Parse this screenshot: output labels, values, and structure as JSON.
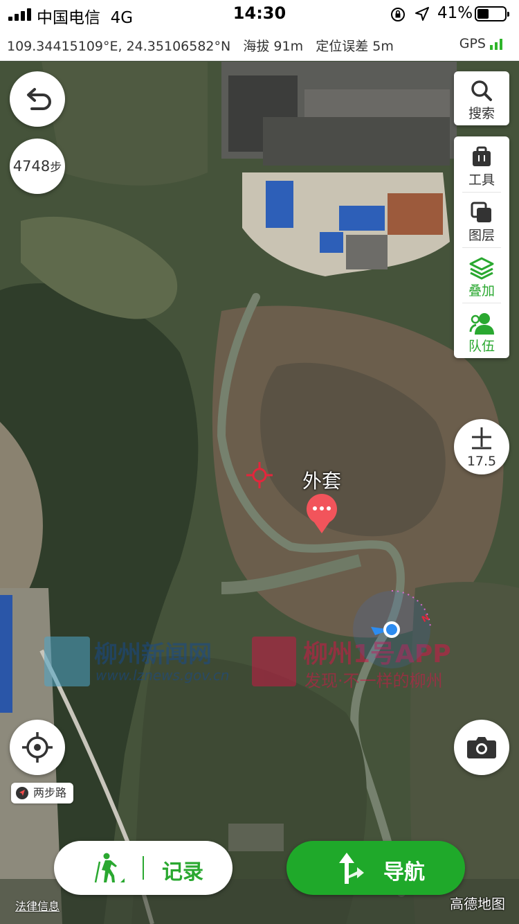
{
  "status_bar": {
    "carrier": "中国电信",
    "network": "4G",
    "time": "14:30",
    "battery_percent": "41%",
    "battery_level": 0.41
  },
  "location_bar": {
    "coordinates": "109.34415109°E, 24.35106582°N",
    "altitude": "海拔 91m",
    "accuracy": "定位误差 5m",
    "gps_label": "GPS"
  },
  "map": {
    "steps": "4748",
    "steps_unit": "步",
    "pin_label": "外套",
    "zoom_level": "17.5",
    "route_chip": "两步路",
    "watermark_left_title": "柳州新闻网",
    "watermark_left_url": "www.lznews.gov.cn",
    "watermark_right_title": "柳州1号APP",
    "watermark_right_slogan": "发现·不一样的柳州",
    "legal": "法律信息",
    "provider": "高德地图",
    "compass_letter": "N"
  },
  "toolbar": {
    "search": "搜索",
    "tools": "工具",
    "layers": "图层",
    "overlay": "叠加",
    "team": "队伍"
  },
  "bottom": {
    "record": "记录",
    "navigate": "导航"
  },
  "colors": {
    "accent_green": "#1fa92a",
    "pin_red": "#f2545b",
    "location_blue": "#2d8cf0"
  }
}
